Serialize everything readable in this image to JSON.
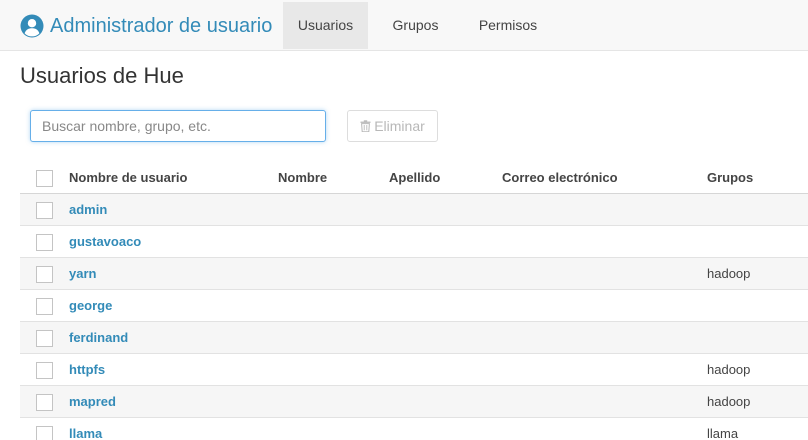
{
  "app": {
    "title": "Administrador de usuario",
    "icon": "user-circle-icon",
    "accent_color": "#338bb8"
  },
  "nav": {
    "tabs": [
      {
        "label": "Usuarios",
        "active": true
      },
      {
        "label": "Grupos",
        "active": false
      },
      {
        "label": "Permisos",
        "active": false
      }
    ]
  },
  "page": {
    "title": "Usuarios de Hue"
  },
  "search": {
    "placeholder": "Buscar nombre, grupo, etc.",
    "value": ""
  },
  "actions": {
    "delete_label": "Eliminar",
    "delete_icon": "trash-icon",
    "delete_enabled": false
  },
  "table": {
    "columns": [
      "Nombre de usuario",
      "Nombre",
      "Apellido",
      "Correo electrónico",
      "Grupos"
    ],
    "rows": [
      {
        "username": "admin",
        "first_name": "",
        "last_name": "",
        "email": "",
        "groups": ""
      },
      {
        "username": "gustavoaco",
        "first_name": "",
        "last_name": "",
        "email": "",
        "groups": ""
      },
      {
        "username": "yarn",
        "first_name": "",
        "last_name": "",
        "email": "",
        "groups": "hadoop"
      },
      {
        "username": "george",
        "first_name": "",
        "last_name": "",
        "email": "",
        "groups": ""
      },
      {
        "username": "ferdinand",
        "first_name": "",
        "last_name": "",
        "email": "",
        "groups": ""
      },
      {
        "username": "httpfs",
        "first_name": "",
        "last_name": "",
        "email": "",
        "groups": "hadoop"
      },
      {
        "username": "mapred",
        "first_name": "",
        "last_name": "",
        "email": "",
        "groups": "hadoop"
      },
      {
        "username": "llama",
        "first_name": "",
        "last_name": "",
        "email": "",
        "groups": "llama"
      }
    ]
  }
}
